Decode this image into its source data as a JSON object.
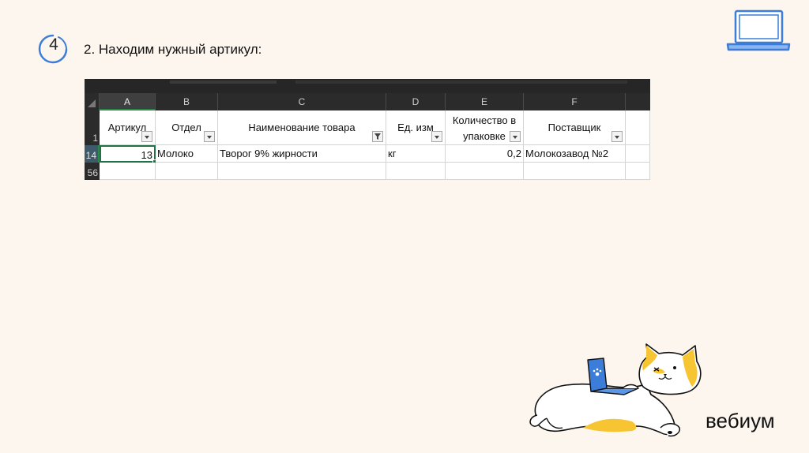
{
  "step": {
    "number": "4",
    "title": "2. Находим нужный артикул:"
  },
  "spreadsheet": {
    "columns": [
      "A",
      "B",
      "C",
      "D",
      "E",
      "F"
    ],
    "header_row_number": "1",
    "headers": [
      "Артикул",
      "Отдел",
      "Наименование товара",
      "Ед. изм",
      "Количество в упаковке",
      "Поставщик"
    ],
    "row_numbers": [
      "14",
      "56"
    ],
    "rows": [
      {
        "article": "13",
        "department": "Молоко",
        "product": "Творог 9% жирности",
        "unit": "кг",
        "quantity": "0,2",
        "supplier": "Молокозавод №2"
      }
    ],
    "selected_cell": "A14"
  },
  "brand": {
    "name": "вебиум"
  },
  "colors": {
    "accent": "#3b7dd8",
    "excel_green": "#217346",
    "background": "#fdf6ef",
    "cat_yellow": "#f6c531"
  }
}
